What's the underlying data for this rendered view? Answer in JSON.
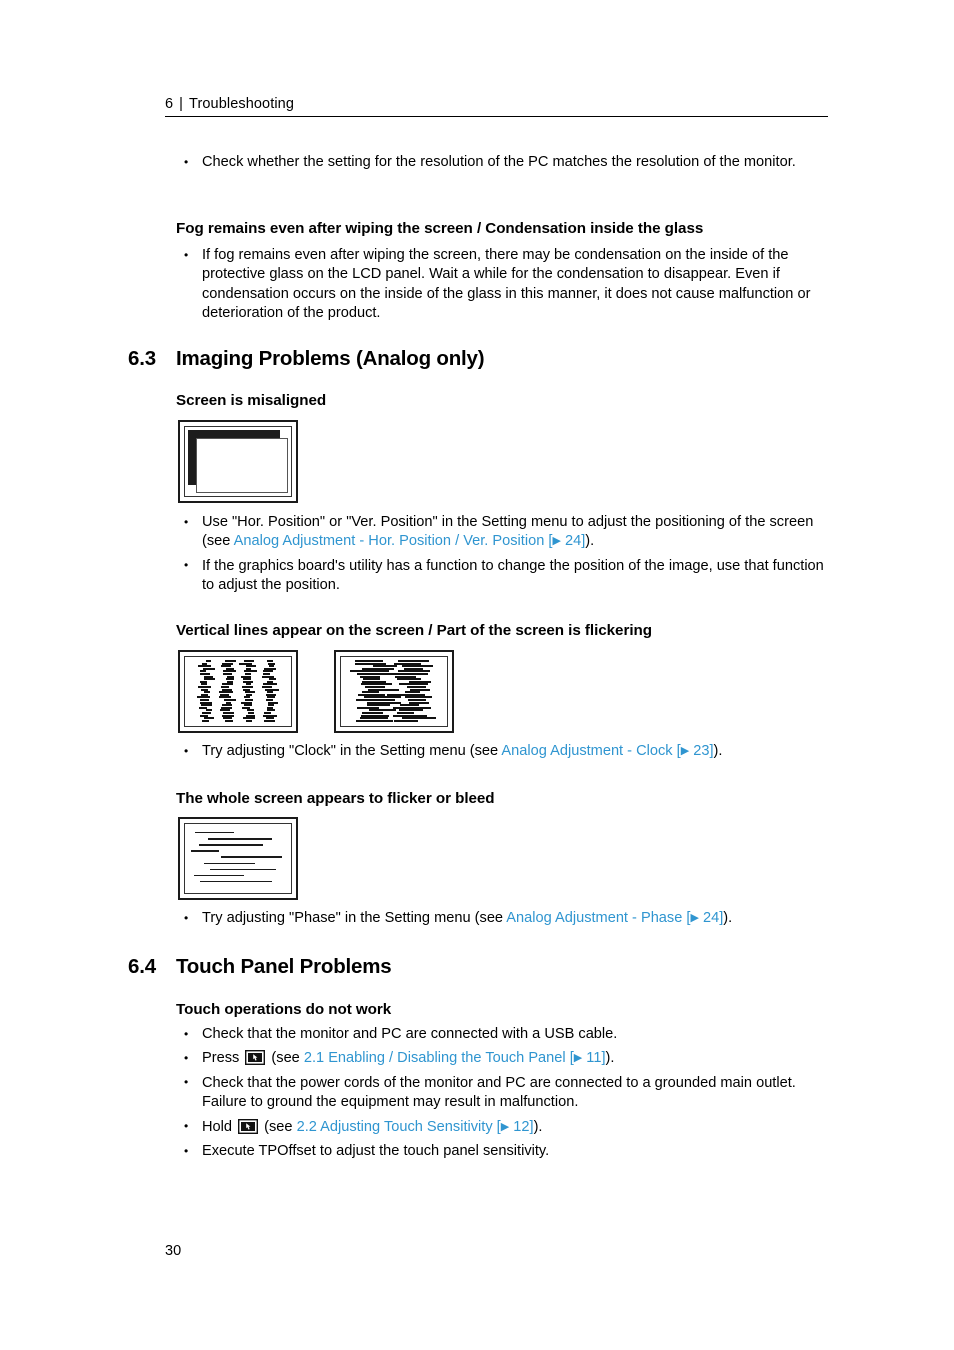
{
  "header": {
    "chapter_number": "6",
    "separator": "|",
    "chapter_title": "Troubleshooting"
  },
  "folio": {
    "page_number": "30"
  },
  "colors": {
    "link": "#2f95d0",
    "text": "#000000",
    "rule": "#000000"
  },
  "intro_bullets": [
    "Check whether the setting for the resolution of the PC matches the resolution of the monitor."
  ],
  "fog_section": {
    "heading": "Fog remains even after wiping the screen / Condensation inside the glass",
    "bullets": [
      "If fog remains even after wiping the screen, there may be condensation on the inside of the protective glass on the LCD panel. Wait a while for the condensation to disappear. Even if condensation occurs on the inside of the glass in this manner, it does not cause malfunction or deterioration of the product."
    ]
  },
  "section_63": {
    "number": "6.3",
    "title": "Imaging Problems (Analog only)",
    "sub_a": {
      "heading": "Screen is misaligned",
      "figure_name": "monitor-misaligned-screen",
      "bullet1_pre": "Use \"Hor. Position\" or \"Ver. Position\" in the Setting menu to adjust the positioning of the screen (see ",
      "bullet1_link": "Analog Adjustment - Hor. Position / Ver. Position [",
      "bullet1_link_arrow": "▶",
      "bullet1_link_page": " 24]",
      "bullet1_post": ").",
      "bullet2": "If the graphics board's utility has a function to change the position of the image, use that function to adjust the position."
    },
    "sub_b": {
      "heading": "Vertical lines appear on the screen / Part of the screen is flickering",
      "figure_left_name": "monitor-vertical-lines-noise",
      "figure_right_name": "monitor-flicker-noise",
      "bullet1_pre": "Try adjusting \"Clock\" in the Setting menu (see ",
      "bullet1_link": "Analog Adjustment - Clock [",
      "bullet1_link_arrow": "▶",
      "bullet1_link_page": " 23]",
      "bullet1_post": ")."
    },
    "sub_c": {
      "heading": "The whole screen appears to flicker or bleed",
      "figure_name": "monitor-flicker-bleed-lines",
      "bullet1_pre": "Try adjusting \"Phase\" in the Setting menu (see ",
      "bullet1_link": "Analog Adjustment - Phase [",
      "bullet1_link_arrow": "▶",
      "bullet1_link_page": " 24]",
      "bullet1_post": ")."
    }
  },
  "section_64": {
    "number": "6.4",
    "title": "Touch Panel Problems",
    "sub_a": {
      "heading": "Touch operations do not work",
      "bullets": [
        {
          "id": "usb-cable",
          "text": "Check that the monitor and PC are connected with a USB cable."
        },
        {
          "id": "press-touch-key",
          "pre": "Press ",
          "icon": "touch-panel-key-icon",
          "mid": " (see ",
          "link": "2.1 Enabling / Disabling the Touch Panel [",
          "link_arrow": "▶",
          "link_page": " 11]",
          "post": ")."
        },
        {
          "id": "power-cords-ground",
          "text": "Check that the power cords of the monitor and PC are connected to a grounded main outlet. Failure to ground the equipment may result in malfunction."
        },
        {
          "id": "hold-touch-key",
          "pre": "Hold ",
          "icon": "touch-panel-key-icon",
          "mid": " (see ",
          "link": "2.2 Adjusting Touch Sensitivity [",
          "link_arrow": "▶",
          "link_page": " 12]",
          "post": ")."
        },
        {
          "id": "tpoffset",
          "text": "Execute TPOffset to adjust the touch panel sensitivity."
        }
      ]
    }
  }
}
